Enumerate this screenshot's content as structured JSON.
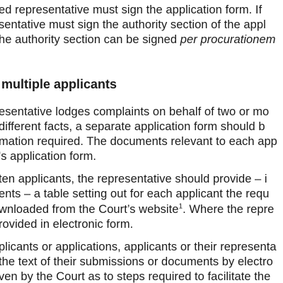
{
  "paragraph_1": {
    "line_1": "ed representative must sign the application form. If",
    "line_2": "sentative must sign the authority section of the appl",
    "line_3_pre": "he authority section can be signed ",
    "line_3_italic": "per procurationem"
  },
  "section_heading": "multiple applicants",
  "paragraph_2": {
    "line_1": "esentative lodges complaints on behalf of two or mo",
    "line_2": "different facts, a separate application form should b",
    "line_3": "mation required. The documents relevant to each app",
    "line_4": "'s application form."
  },
  "paragraph_3": {
    "line_1": "ten applicants, the representative should provide – i",
    "line_2": "ents – a table setting out for each applicant the requ",
    "line_3_pre": "wnloaded from the Court’s website",
    "line_3_footnote": "1",
    "line_3_post": ". Where the repre",
    "line_4": "rovided in electronic form."
  },
  "paragraph_4": {
    "line_1": "plicants or applications, applicants or their representa",
    "line_2": "the text of their submissions or documents by electro",
    "line_3": "ven by the Court as to steps required to facilitate the"
  }
}
